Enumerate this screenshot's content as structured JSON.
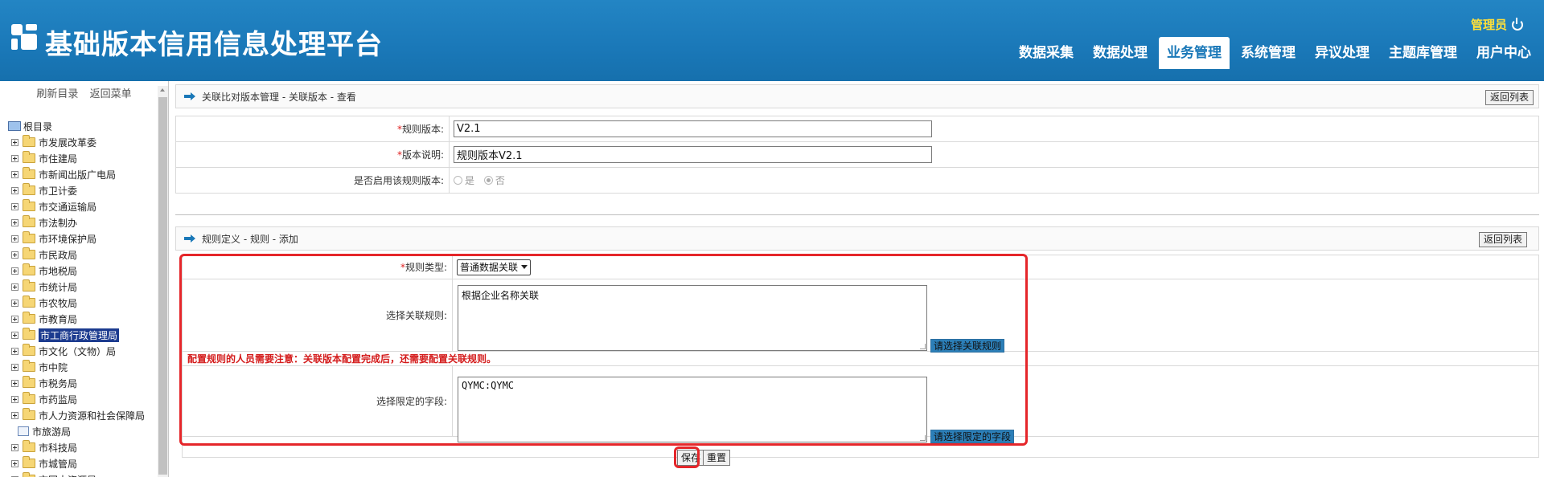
{
  "app": {
    "title": "基础版本信用信息处理平台",
    "user": "管理员"
  },
  "nav": [
    "数据采集",
    "数据处理",
    "业务管理",
    "系统管理",
    "异议处理",
    "主题库管理",
    "用户中心"
  ],
  "sidebar": {
    "refresh_label": "刷新目录",
    "back_label": "返回菜单",
    "root_label": "根目录",
    "items": [
      "市发展改革委",
      "市住建局",
      "市新闻出版广电局",
      "市卫计委",
      "市交通运输局",
      "市法制办",
      "市环境保护局",
      "市民政局",
      "市地税局",
      "市统计局",
      "市农牧局",
      "市教育局",
      "市工商行政管理局",
      "市文化（文物）局",
      "市中院",
      "市税务局",
      "市药监局",
      "市人力资源和社会保障局",
      "市旅游局",
      "市科技局",
      "市城管局",
      "市国土资源局"
    ]
  },
  "version_panel": {
    "breadcrumb": "关联比对版本管理 - 关联版本 - 查看",
    "back_button": "返回列表",
    "fields": {
      "version_label": "规则版本:",
      "version_value": "V2.1",
      "desc_label": "版本说明:",
      "desc_value": "规则版本V2.1",
      "enable_label": "是否启用该规则版本:",
      "enable_yes": "是",
      "enable_no": "否"
    }
  },
  "rule_panel": {
    "breadcrumb": "规则定义 - 规则 - 添加",
    "back_button": "返回列表",
    "type_label": "规则类型:",
    "type_value": "普通数据关联",
    "assoc_label": "选择关联规则:",
    "assoc_value": "根据企业名称关联",
    "assoc_button": "请选择关联规则",
    "note": "配置规则的人员需要注意：关联版本配置完成后，还需要配置关联规则。",
    "field_label": "选择限定的字段:",
    "field_value": "QYMC:QYMC",
    "field_button": "请选择限定的字段",
    "save_button": "保存",
    "reset_button": "重置"
  },
  "required_mark": "*"
}
